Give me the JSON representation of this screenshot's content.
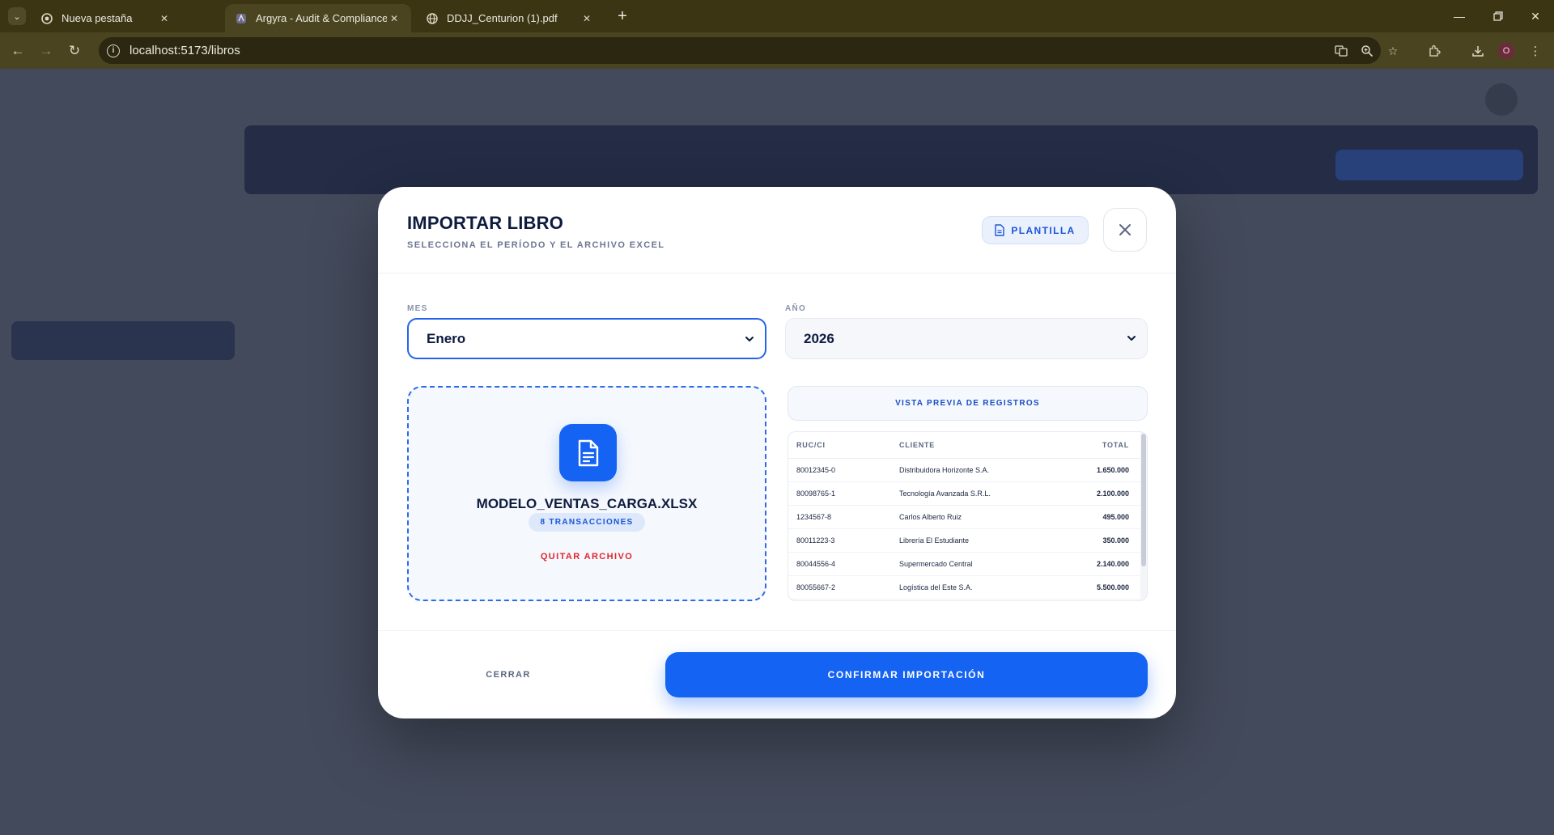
{
  "browser": {
    "tabs": [
      {
        "title": "Nueva pestaña",
        "icon": "chrome-icon"
      },
      {
        "title": "Argyra - Audit & Compliance",
        "icon": "app-favicon"
      },
      {
        "title": "DDJJ_Centurion (1).pdf",
        "icon": "globe-icon"
      }
    ],
    "url": "localhost:5173/libros",
    "profile_initial": "O"
  },
  "modal": {
    "title": "IMPORTAR LIBRO",
    "subtitle": "SELECCIONA EL PERÍODO Y EL ARCHIVO EXCEL",
    "plantilla_label": "PLANTILLA",
    "month_label": "MES",
    "month_value": "Enero",
    "year_label": "AÑO",
    "year_value": "2026",
    "file": {
      "name": "MODELO_VENTAS_CARGA.XLSX",
      "transactions_badge": "8 TRANSACCIONES",
      "remove_label": "QUITAR ARCHIVO"
    },
    "preview_button_label": "VISTA PREVIA DE REGISTROS",
    "table": {
      "headers": [
        "RUC/CI",
        "CLIENTE",
        "TOTAL"
      ],
      "rows": [
        [
          "80012345-0",
          "Distribuidora Horizonte S.A.",
          "1.650.000"
        ],
        [
          "80098765-1",
          "Tecnología Avanzada S.R.L.",
          "2.100.000"
        ],
        [
          "1234567-8",
          "Carlos Alberto Ruiz",
          "495.000"
        ],
        [
          "80011223-3",
          "Librería El Estudiante",
          "350.000"
        ],
        [
          "80044556-4",
          "Supermercado Central",
          "2.140.000"
        ],
        [
          "80055667-2",
          "Logística del Este S.A.",
          "5.500.000"
        ]
      ]
    },
    "close_label": "CERRAR",
    "confirm_label": "CONFIRMAR IMPORTACIÓN"
  },
  "colors": {
    "accent": "#1463f3",
    "danger": "#e0262c",
    "title": "#0d1b3e",
    "overlay": "#434a5b",
    "chrome": "#3b3514"
  }
}
